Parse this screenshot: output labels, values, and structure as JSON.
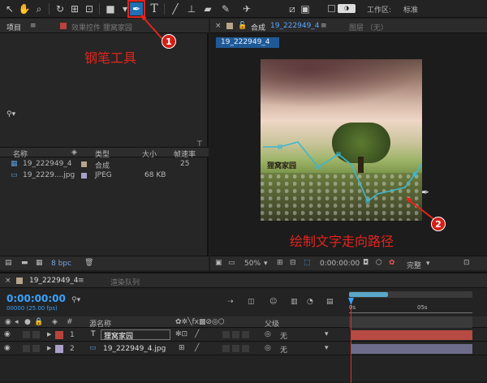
{
  "toolbar": {
    "workspace_label": "工作区:",
    "workspace_value": "标准",
    "icons": [
      "selection-icon",
      "hand-icon",
      "zoom-icon",
      "rotate-icon",
      "camera-orbit-icon",
      "pan-behind-icon",
      "rectangle-icon",
      "pen-icon",
      "text-icon",
      "brush-icon",
      "clone-stamp-icon",
      "eraser-icon",
      "roto-brush-icon",
      "puppet-pin-icon"
    ]
  },
  "project_panel": {
    "tab_project": "项目",
    "tab_effects": "效果控件 狸窝家园",
    "columns": {
      "name": "名称",
      "type": "类型",
      "size": "大小",
      "fps": "帧速率"
    },
    "items": [
      {
        "name": "19_222949_4",
        "type": "合成",
        "size": "",
        "fps": "25"
      },
      {
        "name": "19_2229....jpg",
        "type": "JPEG",
        "size": "68 KB",
        "fps": ""
      }
    ],
    "bpc": "8 bpc"
  },
  "comp_panel": {
    "tab_comp": "合成",
    "tab_comp_name": "19_222949_4",
    "tab_layer": "图层 （无）",
    "sub_tab": "19_222949_4",
    "zoom": "50%",
    "timecode": "0:00:00:00",
    "quality": "完整",
    "image_text": "狸窝家园"
  },
  "timeline": {
    "tab_comp": "19_222949_4",
    "tab_render": "渲染队列",
    "timecode": "0:00:00:00",
    "frames": "00000 (25.00 fps)",
    "col_source": "源名称",
    "col_parent": "父级",
    "ruler": [
      "0s",
      "05s"
    ],
    "layers": [
      {
        "num": "1",
        "name": "狸窝家园",
        "parent": "无",
        "color": "#b8443c"
      },
      {
        "num": "2",
        "name": "19_222949_4.jpg",
        "parent": "无",
        "color": "#a8a0c8"
      }
    ]
  },
  "annotations": {
    "pen_label": "钢笔工具",
    "badge1": "1",
    "path_label": "绘制文字走向路径",
    "badge2": "2"
  },
  "colors": {
    "accent_red": "#e3251d",
    "timecode_blue": "#3aa3ff",
    "layer_bar": "#b84a44"
  }
}
